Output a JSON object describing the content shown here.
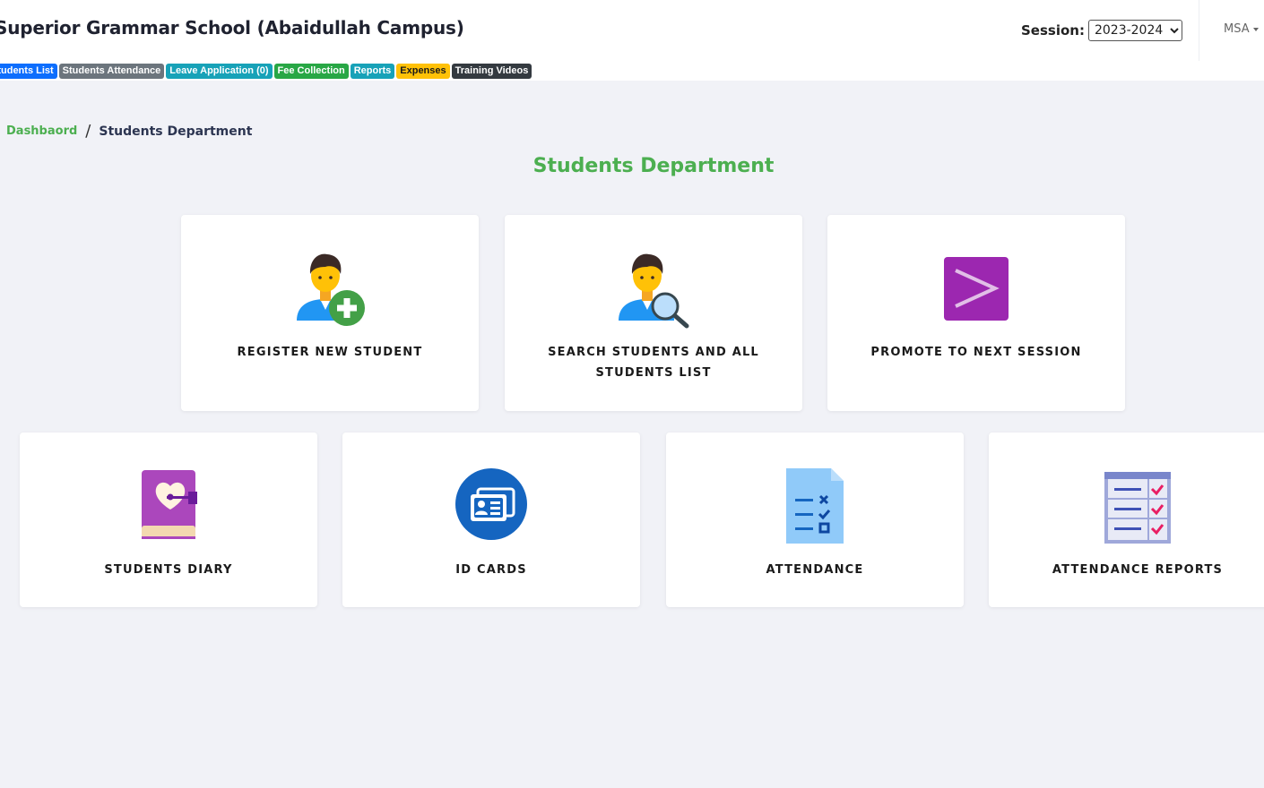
{
  "header": {
    "school_name": "Superior Grammar School (Abaidullah Campus)",
    "session_label": "Session:",
    "session_value": "2023-2024",
    "user": "MSA"
  },
  "nav": [
    {
      "label": "Students List",
      "color": "#0d6efd"
    },
    {
      "label": "Students Attendance",
      "color": "#6c757d"
    },
    {
      "label": "Leave Application (0)",
      "color": "#17a2b8"
    },
    {
      "label": "Fee Collection",
      "color": "#28a745"
    },
    {
      "label": "Reports",
      "color": "#17a2b8"
    },
    {
      "label": "Expenses",
      "color": "#ffc107"
    },
    {
      "label": "Training Videos",
      "color": "#343a40"
    }
  ],
  "breadcrumb": {
    "home": "Dashbaord",
    "separator": "/",
    "current": "Students Department"
  },
  "page_title": "Students Department",
  "cards": [
    {
      "label": "REGISTER NEW STUDENT",
      "icon": "student-add-icon"
    },
    {
      "label": "SEARCH STUDENTS AND ALL STUDENTS LIST",
      "icon": "student-search-icon"
    },
    {
      "label": "PROMOTE TO NEXT SESSION",
      "icon": "promote-icon"
    },
    {
      "label": "STUDENTS DIARY",
      "icon": "diary-icon"
    },
    {
      "label": "ID CARDS",
      "icon": "id-card-icon"
    },
    {
      "label": "ATTENDANCE",
      "icon": "attendance-icon"
    },
    {
      "label": "ATTENDANCE REPORTS",
      "icon": "attendance-report-icon"
    }
  ],
  "colors": {
    "accent_green": "#4caf50",
    "dark_navy": "#2c3551"
  }
}
